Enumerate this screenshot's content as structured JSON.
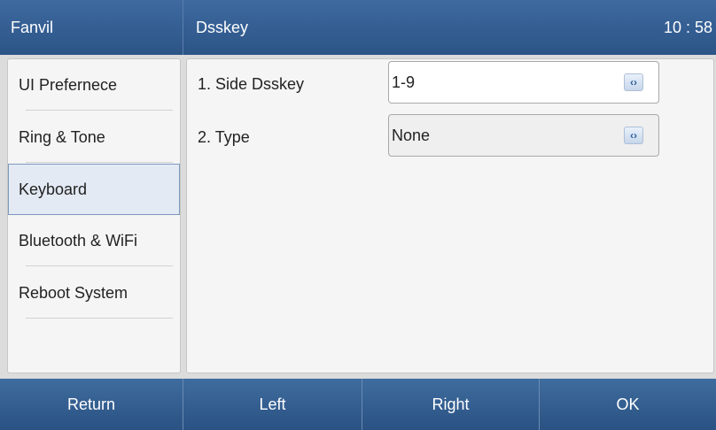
{
  "header": {
    "brand": "Fanvil",
    "title": "Dsskey",
    "clock": "10 : 58"
  },
  "sidebar": {
    "active_index": 2,
    "items": [
      {
        "label": "UI Prefernece"
      },
      {
        "label": "Ring & Tone"
      },
      {
        "label": "Keyboard"
      },
      {
        "label": "Bluetooth & WiFi"
      },
      {
        "label": "Reboot System"
      }
    ]
  },
  "settings": [
    {
      "label": "1.  Side Dsskey",
      "value": "1-9",
      "icon": "left-right-arrows-icon"
    },
    {
      "label": "2.  Type",
      "value": "None",
      "icon": "left-right-arrows-icon"
    }
  ],
  "softkeys": [
    {
      "label": "Return"
    },
    {
      "label": "Left"
    },
    {
      "label": "Right"
    },
    {
      "label": "OK"
    }
  ],
  "colors": {
    "accent": "#2c5486",
    "active_item_bg": "#e3eaf4",
    "panel_bg": "#f5f5f5"
  }
}
